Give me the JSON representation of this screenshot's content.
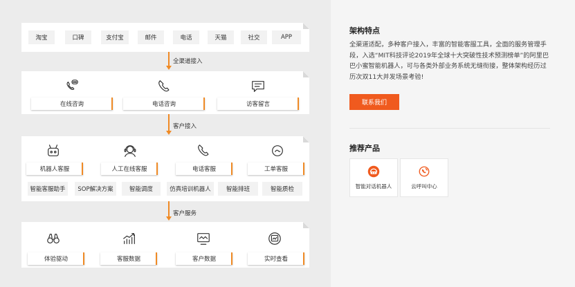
{
  "left": {
    "channels": [
      "淘宝",
      "口碑",
      "支付宝",
      "邮件",
      "电话",
      "天猫",
      "社交",
      "APP"
    ],
    "connectors": [
      "全渠道接入",
      "客户接入",
      "客户服务"
    ],
    "consult": {
      "icons": [
        "bubble-phone-icon",
        "phone-icon",
        "chat-message-icon"
      ],
      "labels": [
        "在线咨询",
        "电话咨询",
        "访客留言"
      ]
    },
    "service": {
      "icons": [
        "robot-icon",
        "agent-headset-icon",
        "phone-icon",
        "ticket-icon"
      ],
      "labels": [
        "机器人客服",
        "人工在线客服",
        "电话客服",
        "工单客服"
      ],
      "tools": [
        "智能客服助手",
        "SOP解决方案",
        "智能调度",
        "仿真培训机器人",
        "智能排班",
        "智能质检"
      ]
    },
    "data": {
      "icons": [
        "binoculars-icon",
        "growth-chart-icon",
        "monitor-icon",
        "realtime-icon"
      ],
      "labels": [
        "体验驱动",
        "客服数据",
        "客户数据",
        "实时查看"
      ]
    }
  },
  "right": {
    "arch_title": "架构特点",
    "arch_desc": "全渠道适配，多种客户接入，丰富的智能客服工具，全面的服务管理手段，入选“MIT科技评论2019年全球十大突破性技术预测榜单”的阿里巴巴小蜜智能机器人，可与各类外部业务系统无缝衔接，整体架构经历过历次双11大并发场景考验!",
    "contact_label": "联系我们",
    "products_title": "推荐产品",
    "products": [
      {
        "label": "智能对话机器人",
        "icon": "robot-dialog-icon"
      },
      {
        "label": "云呼叫中心",
        "icon": "call-center-icon"
      }
    ]
  },
  "colors": {
    "accent": "#f08a24",
    "button": "#f05a1e",
    "panel_bg": "#ececec",
    "icon": "#333333"
  }
}
